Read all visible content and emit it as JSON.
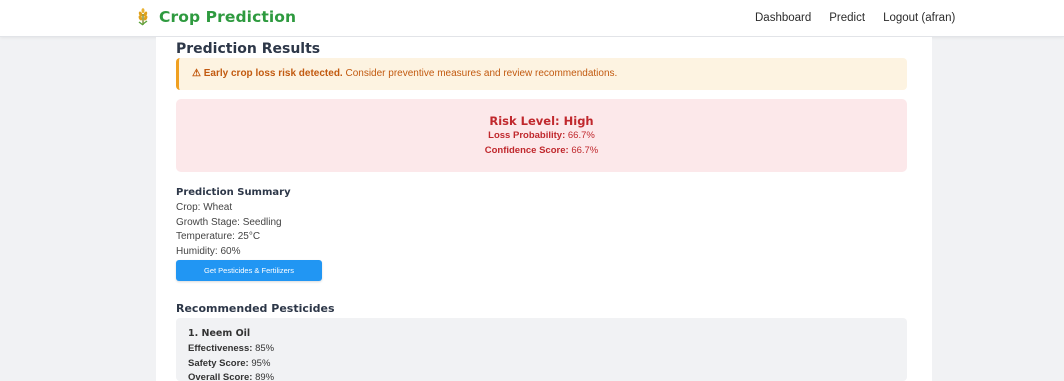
{
  "brand": {
    "icon": "wheat-icon",
    "name": "Crop Prediction",
    "color": "#2e9a3f"
  },
  "nav": {
    "dashboard": "Dashboard",
    "predict": "Predict",
    "logout": "Logout (afran)"
  },
  "page_title": "Prediction Results",
  "alert": {
    "icon": "warning-icon",
    "icon_glyph": "⚠",
    "strong": "Early crop loss risk detected.",
    "text": "Consider preventive measures and review recommendations."
  },
  "risk": {
    "level_text": "Risk Level: High",
    "loss_label": "Loss Probability:",
    "loss_value": "66.7%",
    "confidence_label": "Confidence Score:",
    "confidence_value": "66.7%",
    "color": "#c0282d"
  },
  "summary": {
    "title": "Prediction Summary",
    "crop": "Crop: Wheat",
    "growth_stage": "Growth Stage: Seedling",
    "temperature": "Temperature: 25°C",
    "humidity": "Humidity: 60%"
  },
  "button_label": "Get Pesticides & Fertilizers",
  "pesticides": {
    "title": "Recommended Pesticides",
    "items": [
      {
        "name": "1. Neem Oil",
        "effectiveness_label": "Effectiveness:",
        "effectiveness": "85%",
        "safety_label": "Safety Score:",
        "safety": "95%",
        "overall_label": "Overall Score:",
        "overall": "89%"
      }
    ]
  }
}
